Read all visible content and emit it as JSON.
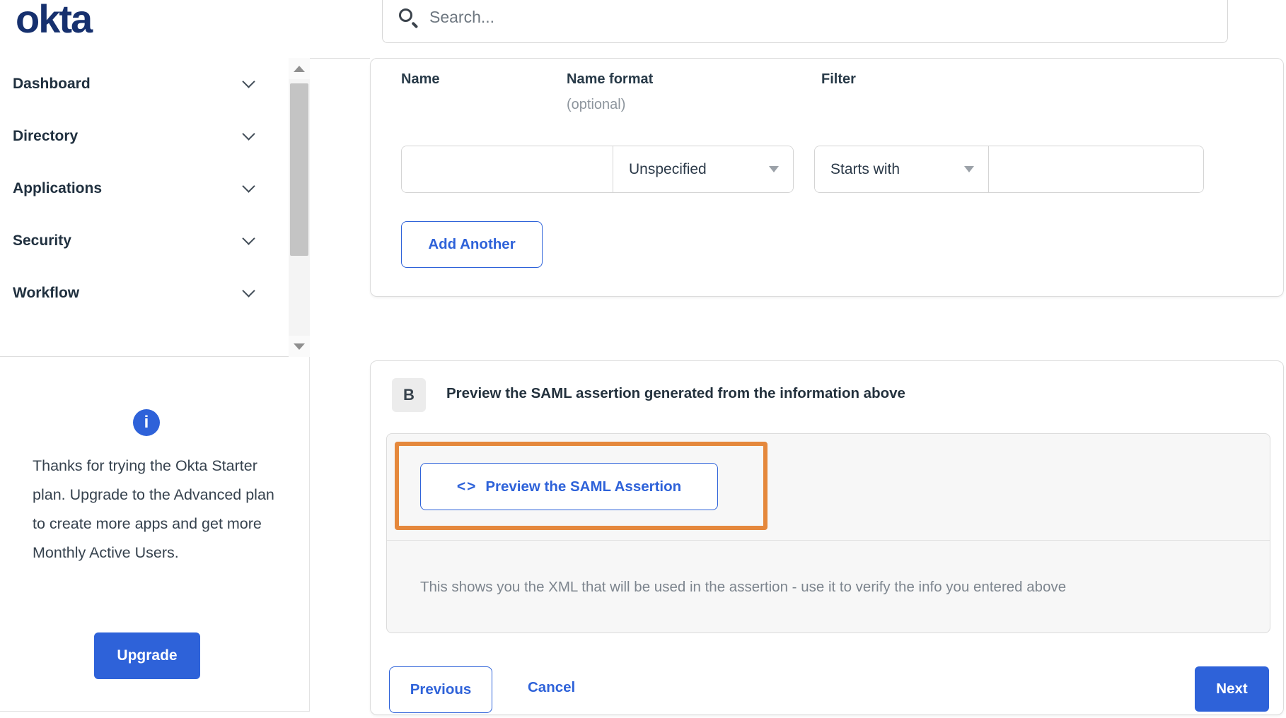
{
  "brand": {
    "logo_text": "okta"
  },
  "header": {
    "search_placeholder": "Search..."
  },
  "sidebar": {
    "items": [
      {
        "label": "Dashboard"
      },
      {
        "label": "Directory"
      },
      {
        "label": "Applications"
      },
      {
        "label": "Security"
      },
      {
        "label": "Workflow"
      }
    ],
    "upsell": {
      "message": "Thanks for trying the Okta Starter plan. Upgrade to the Advanced plan to create more apps and get more Monthly Active Users.",
      "upgrade_label": "Upgrade"
    }
  },
  "attribute_form": {
    "columns": {
      "name_label": "Name",
      "name_format_label": "Name format",
      "name_format_hint": "(optional)",
      "filter_label": "Filter"
    },
    "name_value": "",
    "name_format_value": "Unspecified",
    "filter_type_value": "Starts with",
    "filter_value": "",
    "add_another_label": "Add Another"
  },
  "preview_section": {
    "badge": "B",
    "title": "Preview the SAML assertion generated from the information above",
    "code_glyph": "<>",
    "preview_button_label": "Preview the SAML Assertion",
    "description": "This shows you the XML that will be used in the assertion - use it to verify the info you entered above"
  },
  "footer": {
    "previous_label": "Previous",
    "cancel_label": "Cancel",
    "next_label": "Next"
  },
  "colors": {
    "accent_blue": "#2e62d9",
    "annotation_orange": "#e5883c",
    "logo_navy": "#16306e"
  }
}
